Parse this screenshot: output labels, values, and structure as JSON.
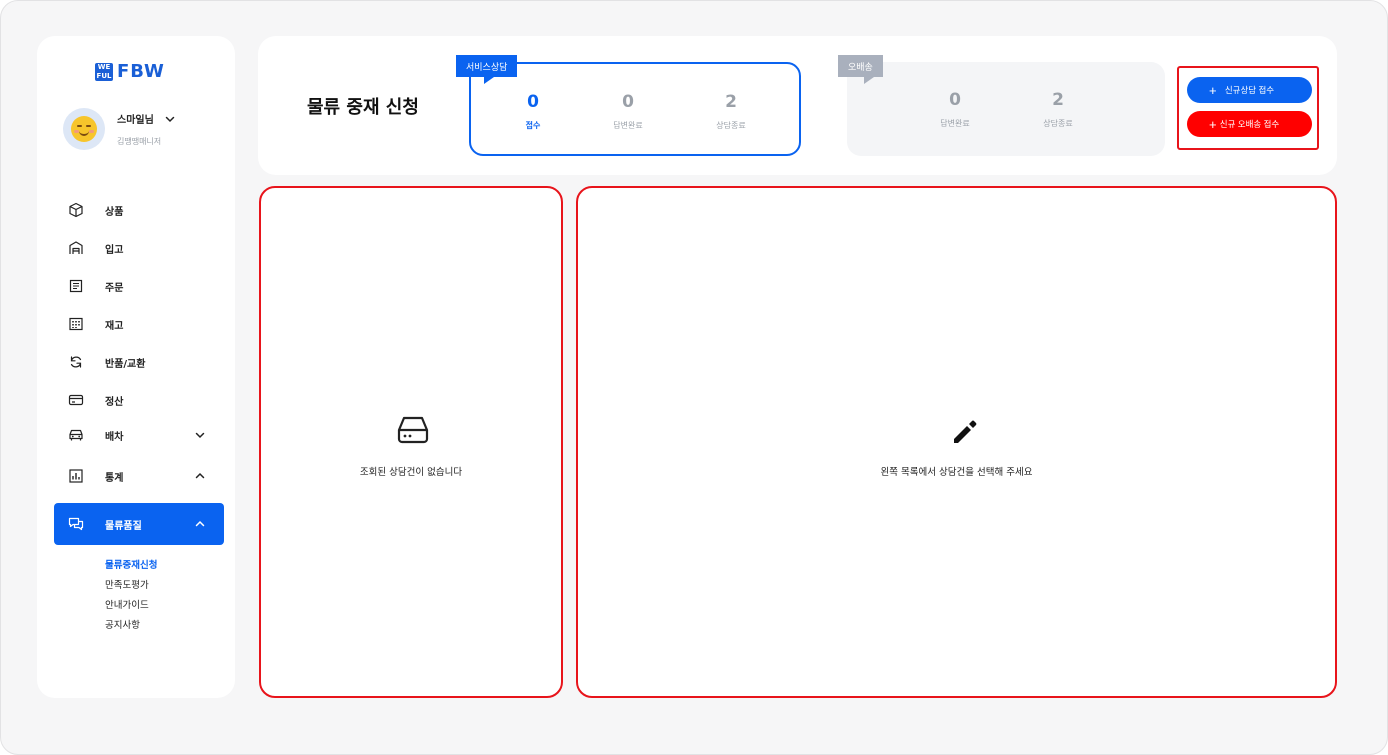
{
  "brand": {
    "logo_text": "FBW",
    "logo_mark": "WE FUL"
  },
  "profile": {
    "name": "스마일님",
    "sub": "김땡땡매니저"
  },
  "nav": {
    "items": [
      {
        "label": "상품",
        "icon": "box-icon"
      },
      {
        "label": "입고",
        "icon": "warehouse-icon"
      },
      {
        "label": "주문",
        "icon": "order-sheet-icon"
      },
      {
        "label": "재고",
        "icon": "inventory-grid-icon"
      },
      {
        "label": "반품/교환",
        "icon": "return-exchange-icon"
      },
      {
        "label": "정산",
        "icon": "card-icon"
      },
      {
        "label": "배차",
        "icon": "truck-icon"
      },
      {
        "label": "통계",
        "icon": "bar-chart-icon"
      },
      {
        "label": "물류품질",
        "icon": "chat-icon"
      }
    ],
    "sub_items": [
      {
        "label": "물류중재신청",
        "active": true
      },
      {
        "label": "만족도평가",
        "active": false
      },
      {
        "label": "안내가이드",
        "active": false
      },
      {
        "label": "공지사항",
        "active": false
      }
    ]
  },
  "header": {
    "title": "물류 중재 신청",
    "service": {
      "tag": "서비스상담",
      "stats": [
        {
          "value": "0",
          "label": "접수"
        },
        {
          "value": "0",
          "label": "답변완료"
        },
        {
          "value": "2",
          "label": "상담종료"
        }
      ]
    },
    "misdelivery": {
      "tag": "오배송",
      "stats": [
        {
          "value": "0",
          "label": "답변완료"
        },
        {
          "value": "2",
          "label": "상담종료"
        }
      ]
    },
    "buttons": {
      "new_consult": "신규상담 접수",
      "new_misdelivery": "신규 오배송 접수",
      "plus": "+"
    }
  },
  "left_panel": {
    "empty_message": "조회된 상담건이 없습니다"
  },
  "right_panel": {
    "empty_message": "왼쪽 목록에서 상담건을 선택해 주세요"
  },
  "colors": {
    "primary": "#0a63f0",
    "danger": "#ff0000",
    "highlight": "#e8141b"
  }
}
